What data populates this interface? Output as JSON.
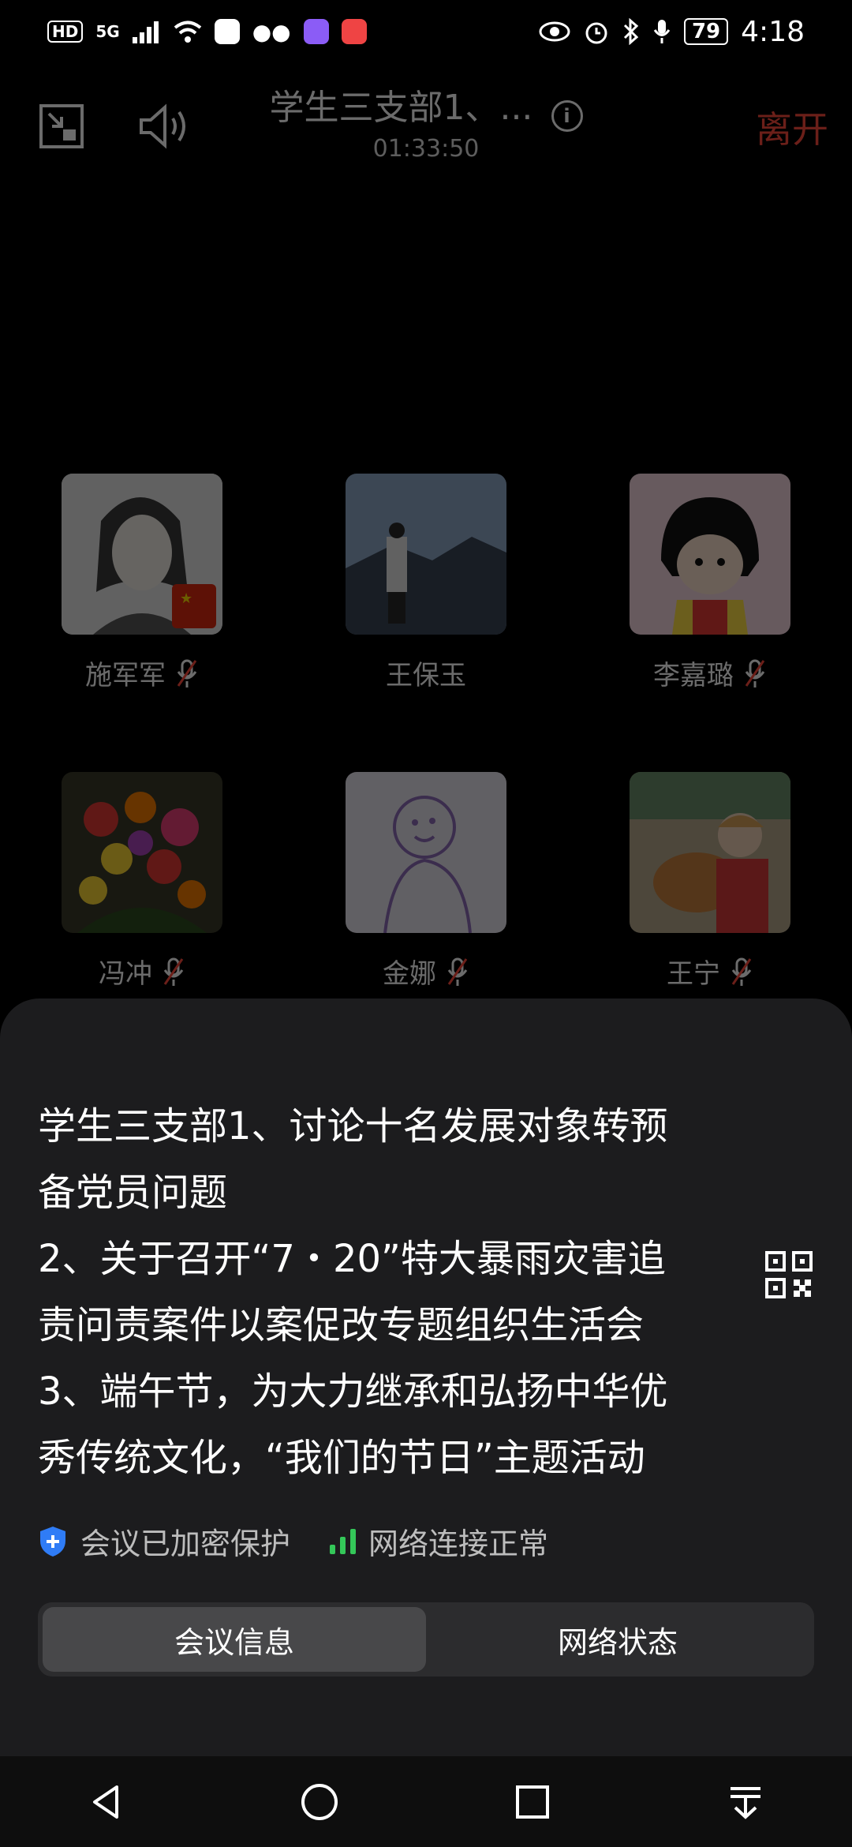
{
  "status_bar": {
    "hd_badge": "HD",
    "network": "5G",
    "battery": "79",
    "time": "4:18"
  },
  "meeting": {
    "title": "学生三支部1、...",
    "timer": "01:33:50",
    "leave_label": "离开"
  },
  "participants": [
    {
      "name": "施军军",
      "muted": true
    },
    {
      "name": "王保玉",
      "muted": false
    },
    {
      "name": "李嘉璐",
      "muted": true
    },
    {
      "name": "冯冲",
      "muted": true
    },
    {
      "name": "金娜",
      "muted": true
    },
    {
      "name": "王宁",
      "muted": true
    }
  ],
  "sheet": {
    "agenda_lines": [
      "学生三支部1、讨论十名发展对象转预",
      "备党员问题",
      "2、关于召开“7・20”特大暴雨灾害追",
      "责问责案件以案促改专题组织生活会",
      "3、端午节，为大力继承和弘扬中华优",
      "秀传统文化，“我们的节日”主题活动"
    ],
    "encryption_text": "会议已加密保护",
    "network_text": "网络连接正常",
    "tabs": [
      {
        "label": "会议信息",
        "active": true
      },
      {
        "label": "网络状态",
        "active": false
      }
    ]
  },
  "colors": {
    "leave": "#ff4a3d",
    "shield": "#2f7cf6",
    "signal": "#34c759"
  }
}
